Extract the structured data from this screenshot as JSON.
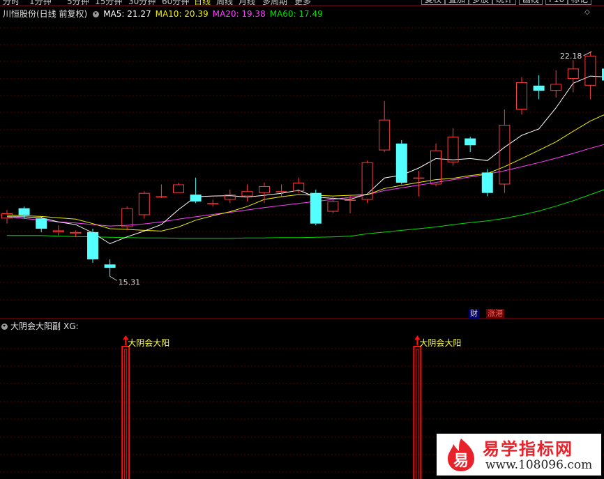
{
  "toolbar": {
    "periods": [
      {
        "label": "分时",
        "active": false
      },
      {
        "label": "1分钟",
        "active": false
      },
      {
        "label": "5分钟",
        "active": false
      },
      {
        "label": "15分钟",
        "active": false
      },
      {
        "label": "30分钟",
        "active": false
      },
      {
        "label": "60分钟",
        "active": false
      },
      {
        "label": "日线",
        "active": true
      },
      {
        "label": "周线",
        "active": false
      },
      {
        "label": "月线",
        "active": false
      },
      {
        "label": "多周期",
        "active": false
      },
      {
        "label": "更多",
        "active": false
      }
    ],
    "buttons": [
      "复权",
      "叠加",
      "多股",
      "统计",
      "画线",
      "F10",
      "标记"
    ]
  },
  "main_title": {
    "stock": "川恒股份(日线 前复权)",
    "ma": [
      {
        "label": "MA5: 21.27",
        "color": "#ffffff"
      },
      {
        "label": "MA10: 20.39",
        "color": "#f0f000"
      },
      {
        "label": "MA20: 19.38",
        "color": "#ff40ff"
      },
      {
        "label": "MA60: 17.49",
        "color": "#00e000"
      }
    ]
  },
  "sub_title": {
    "name": "大阴会大阳副",
    "indicator": "XG:"
  },
  "badges": {
    "fin": "财",
    "zt": "涨港"
  },
  "logo": {
    "name": "易学指标网",
    "url": "www.108096.com",
    "mark": "易"
  },
  "chart_data": [
    {
      "type": "candlestick",
      "title": "川恒股份(日线 前复权)",
      "colors": {
        "up": "#ff3c3c",
        "down": "#54ffff",
        "ma5": "#ffffff",
        "ma10": "#f0f000",
        "ma20": "#ff40ff",
        "ma60": "#00e000"
      },
      "y_range": [
        14.5,
        23.2
      ],
      "annotations": {
        "high": "22.18",
        "low": "15.31"
      },
      "candles": [
        {
          "o": 17.4,
          "c": 17.55,
          "h": 17.65,
          "l": 17.25
        },
        {
          "o": 17.7,
          "c": 17.5,
          "h": 17.75,
          "l": 17.4
        },
        {
          "o": 17.4,
          "c": 17.1,
          "h": 17.45,
          "l": 17.0
        },
        {
          "o": 17.0,
          "c": 17.05,
          "h": 17.2,
          "l": 16.9
        },
        {
          "o": 16.95,
          "c": 17.0,
          "h": 17.05,
          "l": 16.85
        },
        {
          "o": 17.0,
          "c": 16.2,
          "h": 17.1,
          "l": 16.1
        },
        {
          "o": 16.05,
          "c": 15.95,
          "h": 16.2,
          "l": 15.7
        },
        {
          "o": 17.15,
          "c": 17.7,
          "h": 17.75,
          "l": 17.05
        },
        {
          "o": 17.5,
          "c": 18.15,
          "h": 18.2,
          "l": 17.4
        },
        {
          "o": 18.05,
          "c": 18.05,
          "h": 18.4,
          "l": 18.0
        },
        {
          "o": 18.15,
          "c": 18.4,
          "h": 18.45,
          "l": 18.15
        },
        {
          "o": 18.1,
          "c": 17.9,
          "h": 18.6,
          "l": 17.85
        },
        {
          "o": 17.85,
          "c": 17.85,
          "h": 17.95,
          "l": 17.75
        },
        {
          "o": 17.95,
          "c": 18.1,
          "h": 18.25,
          "l": 17.85
        },
        {
          "o": 18.05,
          "c": 18.2,
          "h": 18.4,
          "l": 17.9
        },
        {
          "o": 18.15,
          "c": 18.35,
          "h": 18.45,
          "l": 17.85
        },
        {
          "o": 18.2,
          "c": 18.2,
          "h": 18.4,
          "l": 18.05
        },
        {
          "o": 18.2,
          "c": 18.45,
          "h": 18.6,
          "l": 18.15
        },
        {
          "o": 18.15,
          "c": 17.25,
          "h": 18.25,
          "l": 17.2
        },
        {
          "o": 17.6,
          "c": 17.9,
          "h": 18.05,
          "l": 17.55
        },
        {
          "o": 17.95,
          "c": 17.95,
          "h": 18.1,
          "l": 17.55
        },
        {
          "o": 17.95,
          "c": 19.05,
          "h": 19.1,
          "l": 17.85
        },
        {
          "o": 19.4,
          "c": 20.3,
          "h": 20.85,
          "l": 19.35
        },
        {
          "o": 19.6,
          "c": 18.45,
          "h": 19.7,
          "l": 18.4
        },
        {
          "o": 18.6,
          "c": 18.6,
          "h": 18.8,
          "l": 18.05
        },
        {
          "o": 18.4,
          "c": 19.4,
          "h": 19.6,
          "l": 18.35
        },
        {
          "o": 19.05,
          "c": 19.8,
          "h": 20.05,
          "l": 18.95
        },
        {
          "o": 19.75,
          "c": 19.55,
          "h": 19.8,
          "l": 19.35
        },
        {
          "o": 18.75,
          "c": 18.15,
          "h": 18.85,
          "l": 18.05
        },
        {
          "o": 18.4,
          "c": 20.15,
          "h": 20.6,
          "l": 18.15
        },
        {
          "o": 20.6,
          "c": 21.4,
          "h": 21.55,
          "l": 20.45
        },
        {
          "o": 21.3,
          "c": 21.15,
          "h": 21.6,
          "l": 20.9
        },
        {
          "o": 21.15,
          "c": 21.35,
          "h": 21.75,
          "l": 20.95
        },
        {
          "o": 21.5,
          "c": 21.8,
          "h": 22.05,
          "l": 21.1
        },
        {
          "o": 21.3,
          "c": 22.18,
          "h": 22.3,
          "l": 20.9
        },
        {
          "o": 21.8,
          "c": 21.45,
          "h": 22.15,
          "l": 21.1
        }
      ],
      "ma5": [
        17.45,
        17.45,
        17.42,
        17.3,
        17.22,
        16.98,
        16.66,
        16.86,
        17.03,
        17.22,
        17.66,
        18.04,
        18.06,
        18.07,
        18.03,
        18.08,
        18.14,
        18.23,
        18.03,
        17.99,
        17.96,
        18.12,
        18.59,
        18.67,
        18.88,
        19.16,
        19.12,
        19.16,
        19.1,
        19.49,
        19.84,
        20.03,
        20.65,
        21.37,
        21.58,
        21.55
      ],
      "ma10": [
        17.5,
        17.48,
        17.46,
        17.42,
        17.38,
        17.25,
        17.1,
        17.08,
        17.05,
        17.03,
        17.15,
        17.35,
        17.48,
        17.6,
        17.75,
        17.96,
        18.04,
        18.1,
        18.08,
        18.06,
        18.08,
        18.1,
        18.28,
        18.37,
        18.46,
        18.54,
        18.58,
        18.66,
        18.72,
        18.92,
        19.16,
        19.4,
        19.65,
        19.96,
        20.26,
        20.49
      ],
      "ma20": [
        17.45,
        17.4,
        17.35,
        17.3,
        17.27,
        17.22,
        17.18,
        17.2,
        17.24,
        17.3,
        17.38,
        17.45,
        17.52,
        17.58,
        17.65,
        17.72,
        17.78,
        17.84,
        17.9,
        17.96,
        18.02,
        18.1,
        18.22,
        18.3,
        18.38,
        18.46,
        18.54,
        18.62,
        18.7,
        18.8,
        18.92,
        19.04,
        19.17,
        19.31,
        19.46,
        19.6
      ],
      "ma60": [
        16.9,
        16.9,
        16.9,
        16.88,
        16.87,
        16.86,
        16.85,
        16.84,
        16.83,
        16.83,
        16.82,
        16.82,
        16.82,
        16.82,
        16.83,
        16.83,
        16.84,
        16.84,
        16.85,
        16.86,
        16.88,
        16.95,
        17.0,
        17.05,
        17.1,
        17.15,
        17.22,
        17.28,
        17.33,
        17.4,
        17.5,
        17.62,
        17.76,
        17.92,
        18.1,
        18.28
      ]
    },
    {
      "type": "bar",
      "title": "大阴会大阳副 XG:",
      "signal_label": "大阴会大阳",
      "signal_indices": [
        7,
        24
      ],
      "values": [
        0,
        0,
        0,
        0,
        0,
        0,
        0,
        1,
        0,
        0,
        0,
        0,
        0,
        0,
        0,
        0,
        0,
        0,
        0,
        0,
        0,
        0,
        0,
        0,
        1,
        0,
        0,
        0,
        0,
        0,
        0,
        0,
        0,
        0,
        0,
        0
      ],
      "y_range": [
        0,
        1
      ],
      "colors": {
        "bar": "#ff1010",
        "label": "#ffff40"
      }
    }
  ]
}
